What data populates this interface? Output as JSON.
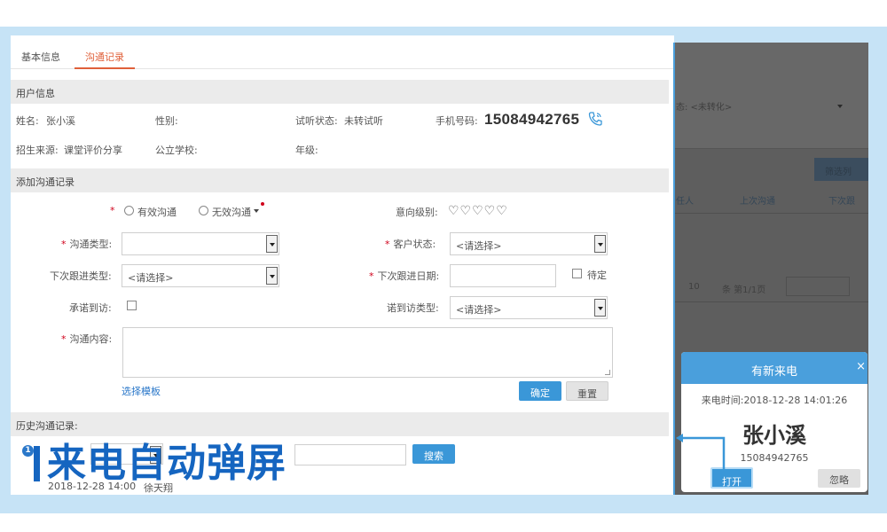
{
  "tabs": [
    "基本信息",
    "沟通记录"
  ],
  "user_info": {
    "section_title": "用户信息",
    "name_label": "姓名:",
    "name_value": "张小溪",
    "gender_label": "性别:",
    "trial_status_label": "试听状态:",
    "trial_status_value": "未转试听",
    "phone_label": "手机号码:",
    "phone_value": "15084942765",
    "source_label": "招生来源:",
    "source_value": "课堂评价分享",
    "school_label": "公立学校:",
    "grade_label": "年级:"
  },
  "add_record": {
    "section_title": "添加沟通记录",
    "radio_valid": "有效沟通",
    "radio_invalid": "无效沟通",
    "intent_label": "意向级别:",
    "intent_hearts": "♡♡♡♡♡",
    "intent_rating": 0,
    "comm_type_label": "沟通类型:",
    "client_status_label": "客户状态:",
    "client_status_value": "<请选择>",
    "next_type_label": "下次跟进类型:",
    "next_type_value": "<请选择>",
    "next_date_label": "下次跟进日期:",
    "pending_label": "待定",
    "promise_label": "承诺到访:",
    "visit_type_label": "诺到访类型:",
    "visit_type_value": "<请选择>",
    "content_label": "沟通内容:",
    "template_link": "选择模板",
    "confirm_label": "确定",
    "reset_label": "重置"
  },
  "history": {
    "section_title": "历史沟通记录:",
    "search_label": "搜索",
    "entry_text": "2018-12-28 14:00",
    "entry_user": "徐天翔"
  },
  "caption": "来电自动弹屏",
  "background_panel": {
    "status_text": "态: <未转化>",
    "button": "筛选列",
    "col1": "任人",
    "col2": "上次沟通",
    "col3": "下次跟",
    "pager_size": "10",
    "pager_text": "条  第1/1页"
  },
  "popup": {
    "title": "有新来电",
    "close": "×",
    "time_label": "来电时间:",
    "time_value": "2018-12-28 14:01:26",
    "name": "张小溪",
    "phone": "15084942765",
    "open_label": "打开",
    "ignore_label": "忽略"
  },
  "colors": {
    "accent": "#4a9fdc",
    "tab_active": "#e0603a",
    "caption": "#1565c0",
    "frame": "#c6e3f6"
  }
}
